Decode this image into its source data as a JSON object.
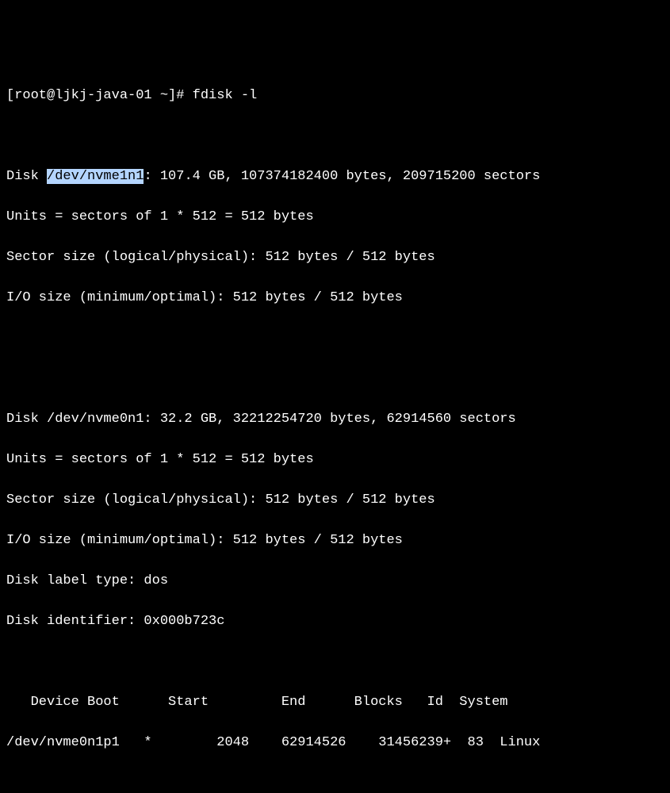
{
  "prompt": {
    "prefix": "[root@ljkj-java-01 ~]# ",
    "command": "fdisk -l"
  },
  "disk1": {
    "line1_pre": "Disk ",
    "line1_hl": "/dev/nvme1n1",
    "line1_post": ": 107.4 GB, 107374182400 bytes, 209715200 sectors",
    "line2": "Units = sectors of 1 * 512 = 512 bytes",
    "line3": "Sector size (logical/physical): 512 bytes / 512 bytes",
    "line4": "I/O size (minimum/optimal): 512 bytes / 512 bytes"
  },
  "disk2": {
    "line1": "Disk /dev/nvme0n1: 32.2 GB, 32212254720 bytes, 62914560 sectors",
    "line2": "Units = sectors of 1 * 512 = 512 bytes",
    "line3": "Sector size (logical/physical): 512 bytes / 512 bytes",
    "line4": "I/O size (minimum/optimal): 512 bytes / 512 bytes",
    "line5": "Disk label type: dos",
    "line6": "Disk identifier: 0x000b723c"
  },
  "table": {
    "header": "   Device Boot      Start         End      Blocks   Id  System",
    "row1": "/dev/nvme0n1p1   *        2048    62914526    31456239+  83  Linux"
  }
}
